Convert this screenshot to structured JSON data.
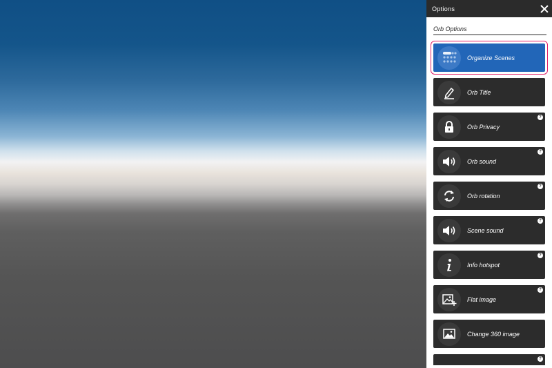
{
  "panel": {
    "title": "Options",
    "section_title": "Orb Options",
    "options": [
      {
        "label": "Organize Scenes",
        "icon": "organize-scenes-icon",
        "active": true,
        "help": false
      },
      {
        "label": "Orb Title",
        "icon": "pen-icon",
        "active": false,
        "help": false
      },
      {
        "label": "Orb Privacy",
        "icon": "lock-icon",
        "active": false,
        "help": true
      },
      {
        "label": "Orb sound",
        "icon": "speaker-icon",
        "active": false,
        "help": true
      },
      {
        "label": "Orb rotation",
        "icon": "rotate-icon",
        "active": false,
        "help": true
      },
      {
        "label": "Scene sound",
        "icon": "speaker-icon",
        "active": false,
        "help": true
      },
      {
        "label": "Info hotspot",
        "icon": "info-icon",
        "active": false,
        "help": true
      },
      {
        "label": "Flat image",
        "icon": "flat-image-icon",
        "active": false,
        "help": true
      },
      {
        "label": "Change 360 image",
        "icon": "image-icon",
        "active": false,
        "help": false
      }
    ],
    "help_glyph": "?"
  },
  "colors": {
    "active": "#2266b8",
    "highlight": "#e0206a",
    "button": "#2c2c2c",
    "header": "#2b2b2b"
  }
}
